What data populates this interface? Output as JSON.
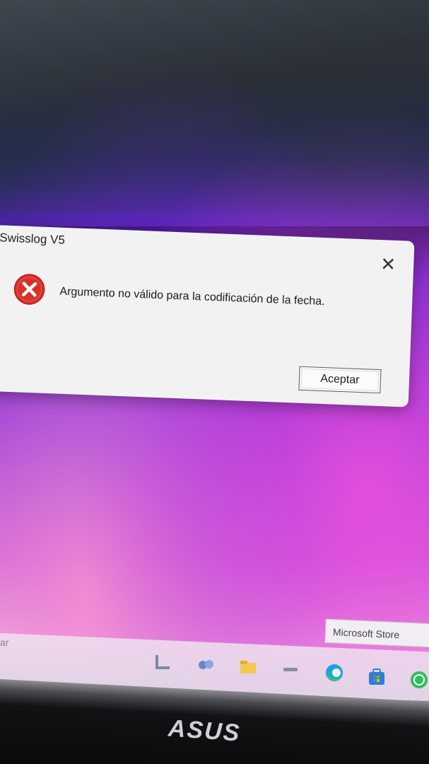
{
  "dialog": {
    "title": "Swisslog V5",
    "close_glyph": "✕",
    "message": "Argumento no válido para la codificación de la fecha.",
    "ok_label": "Aceptar",
    "icon": "error-icon",
    "icon_color": "#d9302a"
  },
  "taskbar": {
    "search_fragment": "ar",
    "tooltip": "Microsoft Store",
    "icons": [
      "file-explorer-icon",
      "chat-icon",
      "folder-icon",
      "settings-icon",
      "edge-icon",
      "microsoft-store-icon",
      "whatsapp-icon"
    ]
  },
  "monitor": {
    "brand": "ASUS"
  },
  "colors": {
    "wallpaper_purple": "#8a2fd8",
    "wallpaper_pink": "#e7a6e0",
    "dialog_bg": "#f2f2f2"
  }
}
